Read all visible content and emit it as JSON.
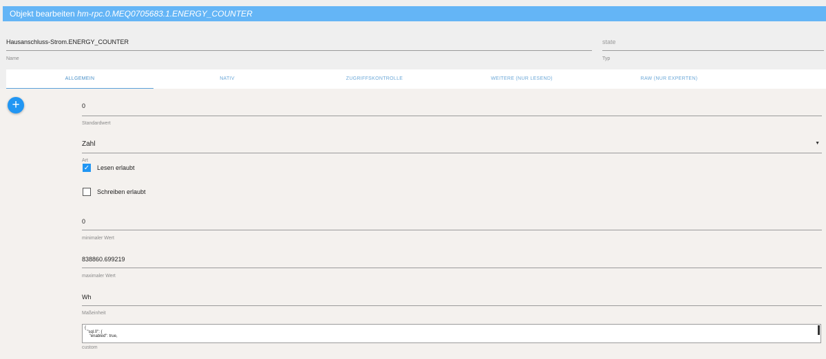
{
  "dialog": {
    "title_prefix": "Objekt bearbeiten",
    "object_id": "hm-rpc.0.MEQ0705683.1.ENERGY_COUNTER"
  },
  "name_field": {
    "value": "Hausanschluss-Strom.ENERGY_COUNTER",
    "label": "Name"
  },
  "type_field": {
    "value": "state",
    "label": "Typ"
  },
  "tabs": [
    {
      "label": "ALLGEMEIN",
      "active": true
    },
    {
      "label": "NATIV"
    },
    {
      "label": "ZUGRIFFSKONTROLLE"
    },
    {
      "label": "WEITERE (NUR LESEND)"
    },
    {
      "label": "RAW (NUR EXPERTEN)"
    }
  ],
  "fab": {
    "icon": "plus-icon",
    "glyph": "+"
  },
  "fields": {
    "default": {
      "value": "0",
      "label": "Standardwert"
    },
    "art": {
      "value": "Zahl",
      "label": "Art",
      "caret": "▼"
    },
    "read": {
      "label": "Lesen erlaubt",
      "checked": true,
      "mark": "✓"
    },
    "write": {
      "label": "Schreiben erlaubt",
      "checked": false
    },
    "min": {
      "value": "0",
      "label": "minimaler Wert"
    },
    "max": {
      "value": "838860.699219",
      "label": "maximaler Wert"
    },
    "unit": {
      "value": "Wh",
      "label": "Maßeinheit"
    },
    "custom": {
      "value": "{\n  \"sql.0\": {\n    \"enabled\": true,",
      "label": "custom"
    }
  },
  "colors": {
    "titlebar": "#64b5f6",
    "accent": "#2196f3",
    "tab_text": "#6ca8d8",
    "content_bg": "#f4f1ee"
  }
}
